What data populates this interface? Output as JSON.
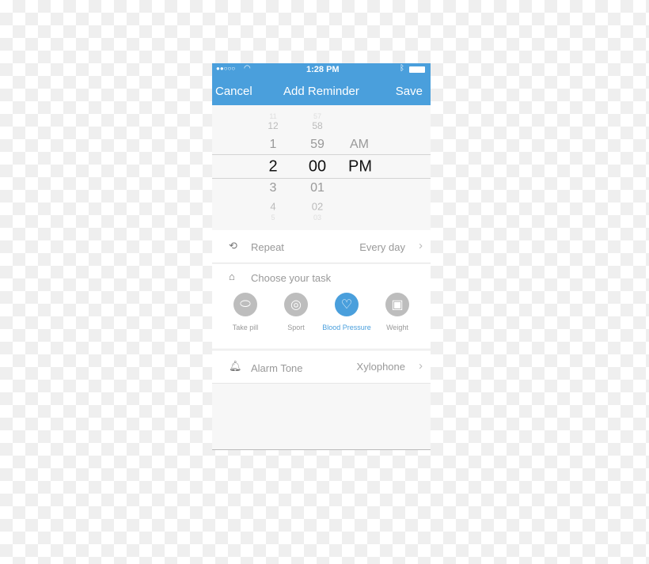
{
  "status_bar": {
    "time": "1:28 PM",
    "signal": "●●○○○",
    "icons": [
      "wifi-icon",
      "bluetooth-icon",
      "battery-icon"
    ]
  },
  "nav": {
    "cancel": "Cancel",
    "title": "Add Reminder",
    "save": "Save"
  },
  "picker": {
    "hours": [
      "11",
      "12",
      "1",
      "2",
      "3",
      "4",
      "5"
    ],
    "minutes": [
      "57",
      "58",
      "59",
      "00",
      "01",
      "02",
      "03"
    ],
    "periods": [
      "AM",
      "PM"
    ],
    "selected": {
      "hour": "2",
      "minute": "00",
      "period": "PM"
    }
  },
  "repeat": {
    "label": "Repeat",
    "value": "Every day"
  },
  "task": {
    "label": "Choose your task",
    "options": [
      {
        "label": "Take pill",
        "icon": "pill-icon"
      },
      {
        "label": "Sport",
        "icon": "watch-icon"
      },
      {
        "label": "Blood Pressure",
        "icon": "heart-icon",
        "selected": true
      },
      {
        "label": "Weight",
        "icon": "scale-icon"
      }
    ]
  },
  "alarm": {
    "label": "Alarm Tone",
    "value": "Xylophone"
  },
  "colors": {
    "accent": "#4a9fdc",
    "inactive": "#bdbdbd"
  }
}
